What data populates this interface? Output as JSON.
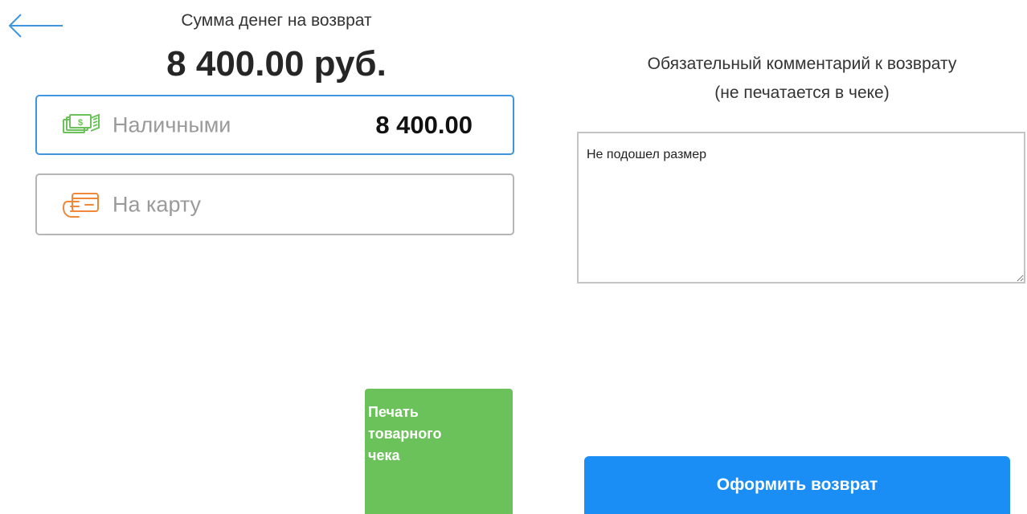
{
  "back": {
    "icon": "arrow-left-icon",
    "color": "#3e95e0"
  },
  "refund": {
    "caption": "Сумма денег на возврат",
    "total": "8 400.00 руб."
  },
  "payment": {
    "cash": {
      "label": "Наличными",
      "value": "8 400.00",
      "icon": "cash-icon",
      "selected": true,
      "icon_color": "#6cc25a"
    },
    "card": {
      "label": "На карту",
      "icon": "card-icon",
      "selected": false,
      "icon_color": "#f0883a"
    }
  },
  "comment": {
    "title_line1": "Обязательный комментарий к возврату",
    "title_line2": "(не печатается в чеке)",
    "value": "Не подошел размер"
  },
  "buttons": {
    "print_line1": "Печать",
    "print_line2": "товарного",
    "print_line3": "чека",
    "submit": "Оформить возврат"
  },
  "colors": {
    "accent": "#3e95e0",
    "print": "#6cc25a",
    "submit": "#1a8ef5"
  }
}
